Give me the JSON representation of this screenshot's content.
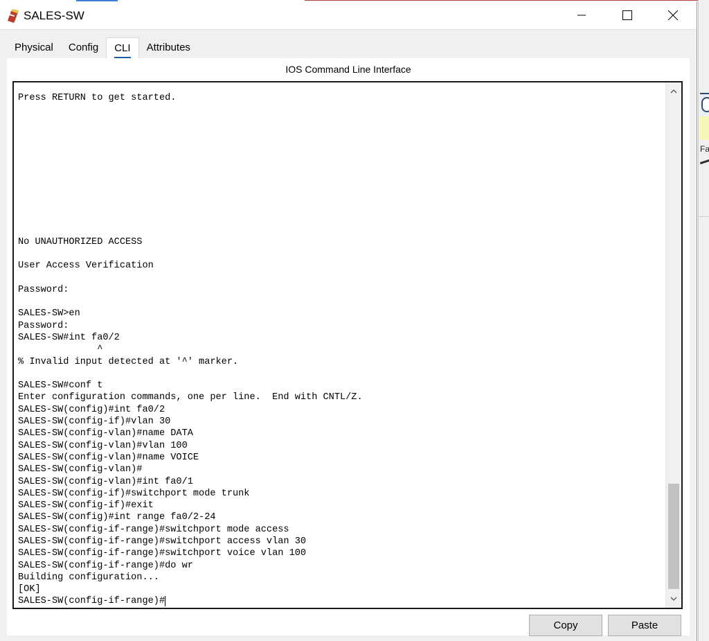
{
  "window": {
    "title": "SALES-SW",
    "icon": "network-switch-icon",
    "controls": {
      "minimize": "minimize-icon",
      "maximize": "maximize-icon",
      "close": "close-icon"
    }
  },
  "tabs": [
    {
      "label": "Physical",
      "active": false
    },
    {
      "label": "Config",
      "active": false
    },
    {
      "label": "CLI",
      "active": true
    },
    {
      "label": "Attributes",
      "active": false
    }
  ],
  "panel": {
    "title": "IOS Command Line Interface"
  },
  "terminal": {
    "lines": [
      "Press RETURN to get started.",
      "",
      "",
      "",
      "",
      "",
      "",
      "",
      "",
      "",
      "",
      "",
      "No UNAUTHORIZED ACCESS",
      "",
      "User Access Verification",
      "",
      "Password:",
      "",
      "SALES-SW>en",
      "Password:",
      "SALES-SW#int fa0/2",
      "              ^",
      "% Invalid input detected at '^' marker.",
      "",
      "SALES-SW#conf t",
      "Enter configuration commands, one per line.  End with CNTL/Z.",
      "SALES-SW(config)#int fa0/2",
      "SALES-SW(config-if)#vlan 30",
      "SALES-SW(config-vlan)#name DATA",
      "SALES-SW(config-vlan)#vlan 100",
      "SALES-SW(config-vlan)#name VOICE",
      "SALES-SW(config-vlan)#",
      "SALES-SW(config-vlan)#int fa0/1",
      "SALES-SW(config-if)#switchport mode trunk",
      "SALES-SW(config-if)#exit",
      "SALES-SW(config)#int range fa0/2-24",
      "SALES-SW(config-if-range)#switchport mode access",
      "SALES-SW(config-if-range)#switchport access vlan 30",
      "SALES-SW(config-if-range)#switchport voice vlan 100",
      "SALES-SW(config-if-range)#do wr",
      "Building configuration...",
      "[OK]"
    ],
    "prompt": "SALES-SW(config-if-range)#",
    "scroll_position": 0.85
  },
  "buttons": {
    "copy": "Copy",
    "paste": "Paste"
  },
  "background_app": {
    "label": "Fa"
  }
}
